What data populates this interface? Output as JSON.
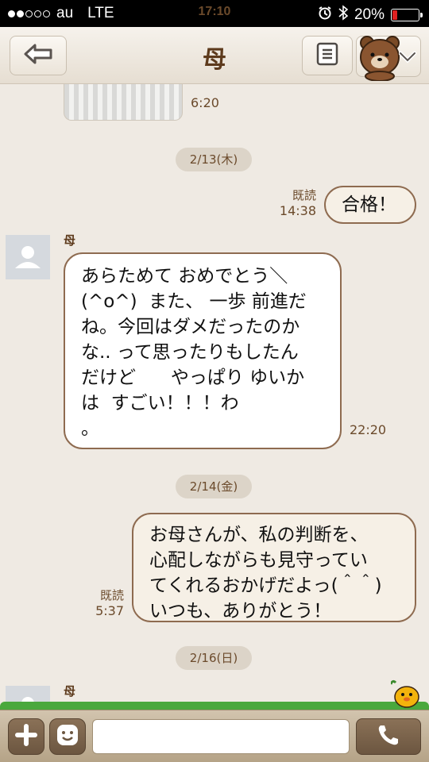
{
  "status_bar": {
    "carrier": "au",
    "network": "LTE",
    "time": "17:10",
    "battery": "20%",
    "battery_level": 0.2,
    "signal_dots_filled": 2,
    "signal_dots_total": 5
  },
  "header": {
    "title": "母"
  },
  "messages": {
    "img_time": "6:20",
    "date1": "2/13(木)",
    "m1_read": "既読",
    "m1_time": "14:38",
    "m1_text": "合格！",
    "m2_sender": "母",
    "m2_text": "あらためて おめでとう＼\n(^o^)  また、 一歩 前進だ\nね。今回はダメだったのか\nな.. って思ったりもしたん\nだけど      やっぱり ゆいか\nは  すごい！！！わ\n。",
    "m2_time": "22:20",
    "date2": "2/14(金)",
    "m3_read": "既読",
    "m3_time": "5:37",
    "m3_text": "お母さんが、私の判断を、\n心配しながらも見守ってい\nてくれるおかげだよっ(＾＾)\nいつも、ありがとう！",
    "date3": "2/16(日)",
    "m4_sender": "母"
  },
  "input": {
    "placeholder": "",
    "value": ""
  },
  "colors": {
    "background": "#efeae3",
    "accent_brown": "#5d3a1c",
    "bubble_border": "#8e6b50",
    "battery_low": "#e02020"
  }
}
